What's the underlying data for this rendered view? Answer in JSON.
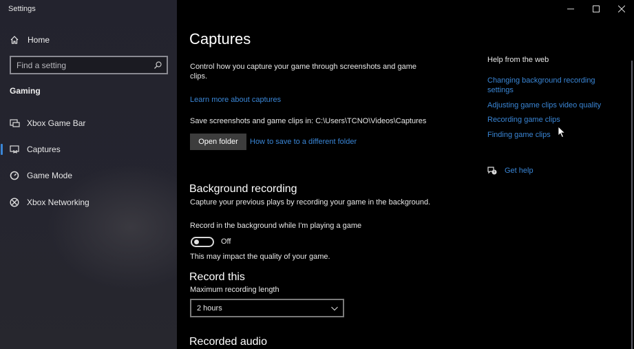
{
  "app": {
    "title": "Settings"
  },
  "sidebar": {
    "home_label": "Home",
    "search_placeholder": "Find a setting",
    "section_title": "Gaming",
    "items": [
      {
        "label": "Xbox Game Bar",
        "icon": "game-bar-icon",
        "active": false
      },
      {
        "label": "Captures",
        "icon": "captures-icon",
        "active": true
      },
      {
        "label": "Game Mode",
        "icon": "game-mode-icon",
        "active": false
      },
      {
        "label": "Xbox Networking",
        "icon": "xbox-icon",
        "active": false
      }
    ]
  },
  "window_controls": {
    "minimize": "minimize-icon",
    "maximize": "maximize-icon",
    "close": "close-icon"
  },
  "main": {
    "title": "Captures",
    "description": "Control how you capture your game through screenshots and game clips.",
    "learn_more_link": "Learn more about captures",
    "save_location_label": "Save screenshots and game clips in: C:\\Users\\TCNO\\Videos\\Captures",
    "open_folder_button": "Open folder",
    "different_folder_link": "How to save to a different folder",
    "background_recording": {
      "heading": "Background recording",
      "description": "Capture your previous plays by recording your game in the background.",
      "toggle_label": "Record in the background while I'm playing a game",
      "toggle_state": "Off",
      "toggle_on": false,
      "note": "This may impact the quality of your game."
    },
    "record_this": {
      "heading": "Record this",
      "max_length_label": "Maximum recording length",
      "max_length_value": "2 hours"
    },
    "recorded_audio": {
      "heading": "Recorded audio"
    }
  },
  "help": {
    "title": "Help from the web",
    "links": [
      "Changing background recording settings",
      "Adjusting game clips video quality",
      "Recording game clips",
      "Finding game clips"
    ],
    "get_help_label": "Get help"
  },
  "colors": {
    "accent": "#3a86d6",
    "sidebar_bg": "#24242e",
    "main_bg": "#000000",
    "button_bg": "#3d3d3d"
  }
}
